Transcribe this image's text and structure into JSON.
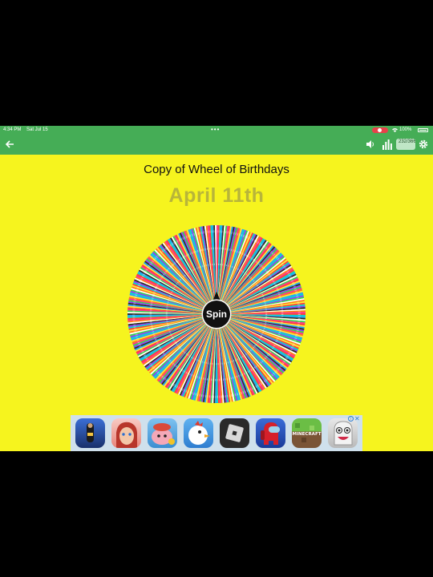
{
  "status_bar": {
    "time": "4:34 PM",
    "date": "Sat Jul 15",
    "battery_percent": "100%",
    "recording": true
  },
  "app_bar": {
    "back_icon": "arrow-left-icon",
    "volume_icon": "volume-icon",
    "stats_icon": "bar-chart-icon",
    "counter": "232/366",
    "settings_icon": "gear-icon",
    "color": "#45ad56"
  },
  "wheel": {
    "title": "Copy of Wheel of Birthdays",
    "result": "April 11th",
    "spin_label": "Spin",
    "segment_count": 366,
    "segment_colors": [
      "#ff2e93",
      "#1fa3ff",
      "#34d058",
      "#ffe63b",
      "#8a3dff",
      "#ff7a1a",
      "#00d4d4",
      "#ffffff",
      "#ff3b3b",
      "#2a2a2a"
    ],
    "background": "#f6f41e"
  },
  "ad": {
    "apps": [
      {
        "name": "Subway Surfers",
        "icon": "subway-surfers-icon"
      },
      {
        "name": "Beauty Salon",
        "icon": "salon-girl-icon"
      },
      {
        "name": "Coin Master",
        "icon": "coin-master-icon"
      },
      {
        "name": "Crossy Chicken",
        "icon": "chicken-icon"
      },
      {
        "name": "Roblox",
        "icon": "roblox-icon"
      },
      {
        "name": "Among Us",
        "icon": "among-us-icon"
      },
      {
        "name": "Minecraft",
        "icon": "minecraft-icon"
      },
      {
        "name": "Toca Monster",
        "icon": "monster-icon"
      }
    ],
    "minecraft_label": "MINECRAFT",
    "close_glyph": "✕",
    "info_glyph": "i"
  }
}
